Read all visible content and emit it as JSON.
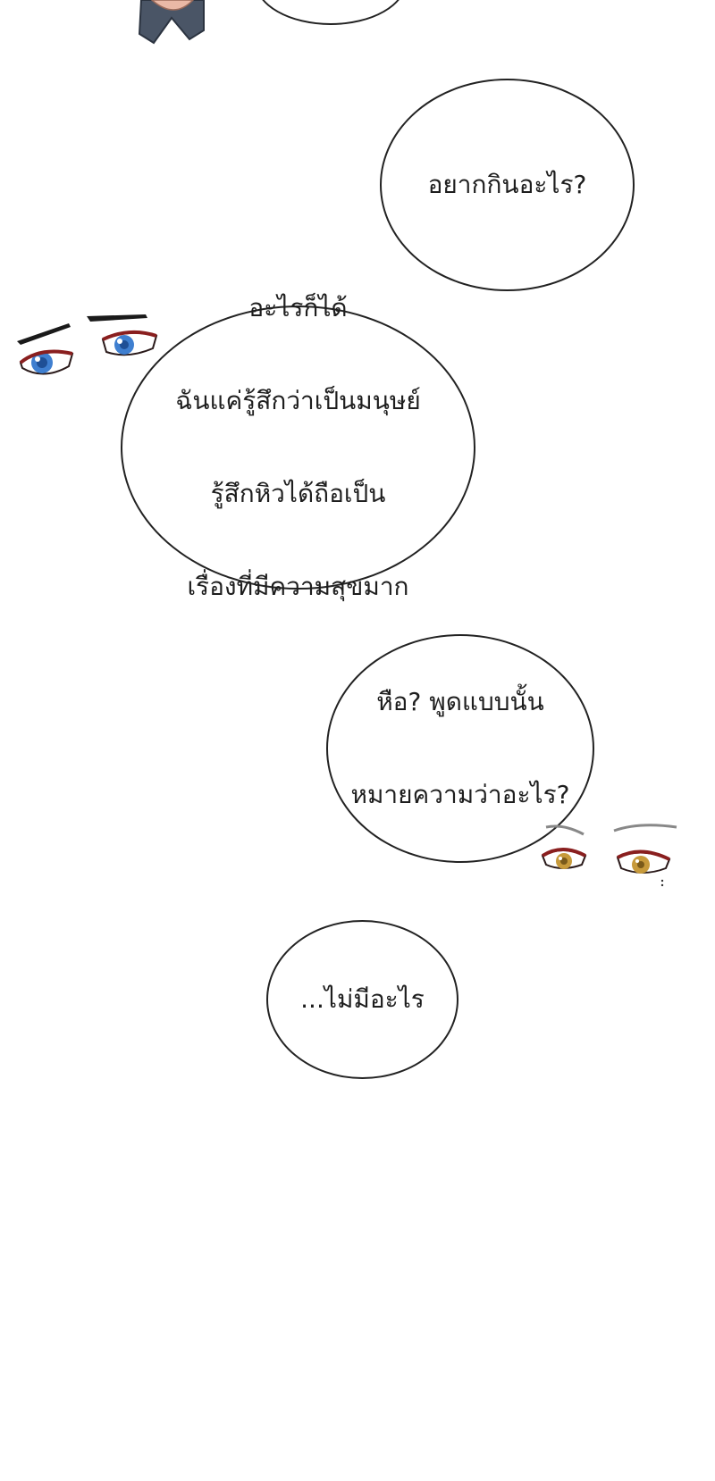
{
  "bubbles": {
    "b1": {
      "lines": [
        "อยากกินอะไร?"
      ]
    },
    "b2": {
      "lines": [
        "อะไรก็ได้",
        "ฉันแค่รู้สึกว่าเป็นมนุษย์",
        "รู้สึกหิวได้ถือเป็น",
        "เรื่องที่มีความสุขมาก"
      ]
    },
    "b3": {
      "lines": [
        "หือ? พูดแบบนั้น",
        "หมายความว่าอะไร?"
      ]
    },
    "b4": {
      "lines": [
        "...ไม่มีอะไร"
      ]
    }
  },
  "colors": {
    "background": "#ffffff",
    "bubble_border": "#222222",
    "text": "#1e1e1e",
    "blue_eye": "#3f7fd0",
    "amber_eye": "#c79a3b",
    "eye_liner": "#2a1a1a",
    "lash_red": "#8a1f1f"
  }
}
